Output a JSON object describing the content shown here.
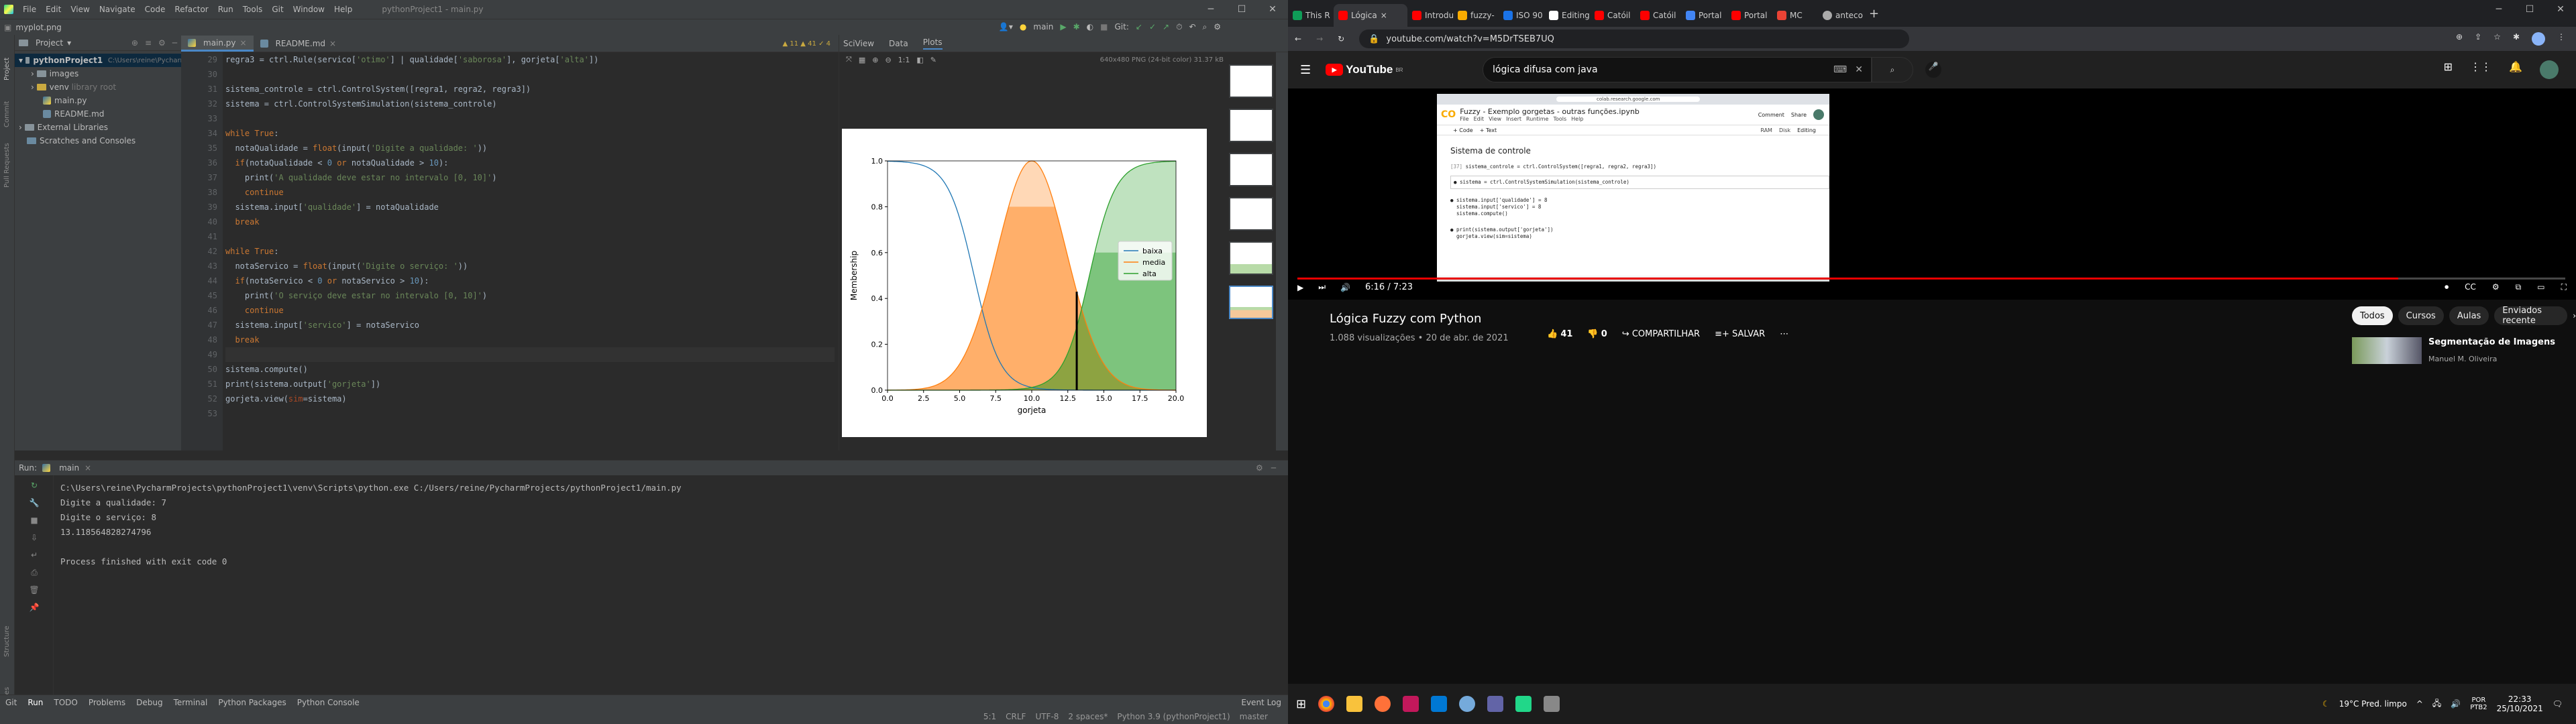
{
  "ide": {
    "menu": [
      "File",
      "Edit",
      "View",
      "Navigate",
      "Code",
      "Refactor",
      "Run",
      "Tools",
      "Git",
      "Window",
      "Help"
    ],
    "window_title": "pythonProject1 - main.py",
    "breadcrumb": "myplot.png",
    "branch": "main",
    "project_label": "Project",
    "project_tree": [
      {
        "label": "pythonProject1",
        "kind": "folder",
        "note": "C:\\Users\\reine\\PycharmProjects\\pythonProject1"
      },
      {
        "label": "images",
        "kind": "folder"
      },
      {
        "label": "venv",
        "kind": "folder",
        "note": "library root"
      },
      {
        "label": "main.py",
        "kind": "py"
      },
      {
        "label": "README.md",
        "kind": "md"
      },
      {
        "label": "External Libraries",
        "kind": "folder"
      },
      {
        "label": "Scratches and Consoles",
        "kind": "folder"
      }
    ],
    "tabs": [
      "main.py",
      "README.md"
    ],
    "gutter_numbers": [
      "29",
      "30",
      "31",
      "32",
      "33",
      "34",
      "35",
      "36",
      "37",
      "38",
      "39",
      "40",
      "41",
      "42",
      "43",
      "44",
      "45",
      "46",
      "47",
      "48",
      "49",
      "50",
      "51",
      "52",
      "53"
    ],
    "warnings": "▲ 11  ▲ 41  ✓ 4",
    "sci_tabs": [
      "SciView",
      "Data",
      "Plots"
    ],
    "plot_info": "640x480 PNG (24-bit color) 31.37 kB",
    "run_label": "Run:",
    "run_tab": "main",
    "console": [
      "C:\\Users\\reine\\PycharmProjects\\pythonProject1\\venv\\Scripts\\python.exe C:/Users/reine/PycharmProjects/pythonProject1/main.py",
      "Digite a qualidade: 7",
      "Digite o serviço: 8",
      "13.118564828274796",
      "",
      "Process finished with exit code 0"
    ],
    "tool_windows": [
      "Git",
      "Run",
      "TODO",
      "Problems",
      "Debug",
      "Terminal",
      "Python Packages",
      "Python Console"
    ],
    "event_log": "Event Log",
    "status": [
      "5:1",
      "CRLF",
      "UTF-8",
      "2 spaces*",
      "Python 3.9 (pythonProject1)",
      "master"
    ]
  },
  "browser": {
    "tabs": [
      "This R",
      "Lógica",
      "Introdu",
      "fuzzy-",
      "ISO 90",
      "Editing",
      "Catóil",
      "Catóil",
      "Portal",
      "Portal",
      "MC",
      "anteco"
    ],
    "url": "youtube.com/watch?v=M5DrTSEB7UQ",
    "search_text": "lógica difusa com java",
    "youtube_country": "BR",
    "video": {
      "notebook_title": "Fuzzy - Exemplo gorgetas - outras funções.ipynb",
      "notebook_menu": [
        "File",
        "Edit",
        "View",
        "Insert",
        "Runtime",
        "Tools",
        "Help"
      ],
      "colab_url": "colab.research.google.com",
      "comment": "Comment",
      "share": "Share",
      "code_btn": "+ Code",
      "text_btn": "+ Text",
      "editing": "Editing",
      "ram": "RAM",
      "disk": "Disk",
      "section": "Sistema de controle",
      "cell_prompt": "[37]",
      "time": "6:16 / 7:23",
      "progress": 0.868
    },
    "title": "Lógica Fuzzy com Python",
    "meta": "1.088 visualizações • 20 de abr. de 2021",
    "likes": "41",
    "dislikes": "0",
    "share": "COMPARTILHAR",
    "save": "SALVAR",
    "chips": [
      "Todos",
      "Cursos",
      "Aulas",
      "Enviados recente"
    ],
    "related_title": "Segmentação de Imagens",
    "related_channel": "Manuel M. Oliveira",
    "weather": "19°C  Pred. limpo",
    "lang": "POR",
    "lang2": "PTB2",
    "clock": "22:33",
    "date": "25/10/2021"
  },
  "chart_data": {
    "type": "area",
    "x_range": [
      0,
      20
    ],
    "y_range": [
      0,
      1
    ],
    "xlabel": "gorjeta",
    "ylabel": "Membership",
    "xticks": [
      "0.0",
      "2.5",
      "5.0",
      "7.5",
      "10.0",
      "12.5",
      "15.0",
      "17.5",
      "20.0"
    ],
    "yticks": [
      "0.0",
      "0.2",
      "0.4",
      "0.6",
      "0.8",
      "1.0"
    ],
    "series": [
      {
        "name": "baixa",
        "color": "#1f77b4",
        "shape": "z-sigmoid",
        "points": [
          [
            0,
            1
          ],
          [
            2,
            0.98
          ],
          [
            4,
            0.85
          ],
          [
            6,
            0.5
          ],
          [
            8,
            0.12
          ],
          [
            10,
            0.01
          ],
          [
            12,
            0
          ]
        ]
      },
      {
        "name": "media",
        "color": "#ff7f0e",
        "shape": "gaussian",
        "center": 10,
        "points": [
          [
            4,
            0.02
          ],
          [
            6,
            0.2
          ],
          [
            8,
            0.7
          ],
          [
            10,
            1
          ],
          [
            12,
            0.7
          ],
          [
            14,
            0.2
          ],
          [
            16,
            0.02
          ]
        ]
      },
      {
        "name": "alta",
        "color": "#2ca02c",
        "shape": "s-sigmoid",
        "points": [
          [
            8,
            0
          ],
          [
            10,
            0.01
          ],
          [
            12,
            0.12
          ],
          [
            14,
            0.5
          ],
          [
            16,
            0.85
          ],
          [
            18,
            0.98
          ],
          [
            20,
            1
          ]
        ]
      }
    ],
    "activation": {
      "media_level": 0.8,
      "alta_level": 0.6
    },
    "defuzzified_value": 13.12,
    "legend_position": "right"
  }
}
